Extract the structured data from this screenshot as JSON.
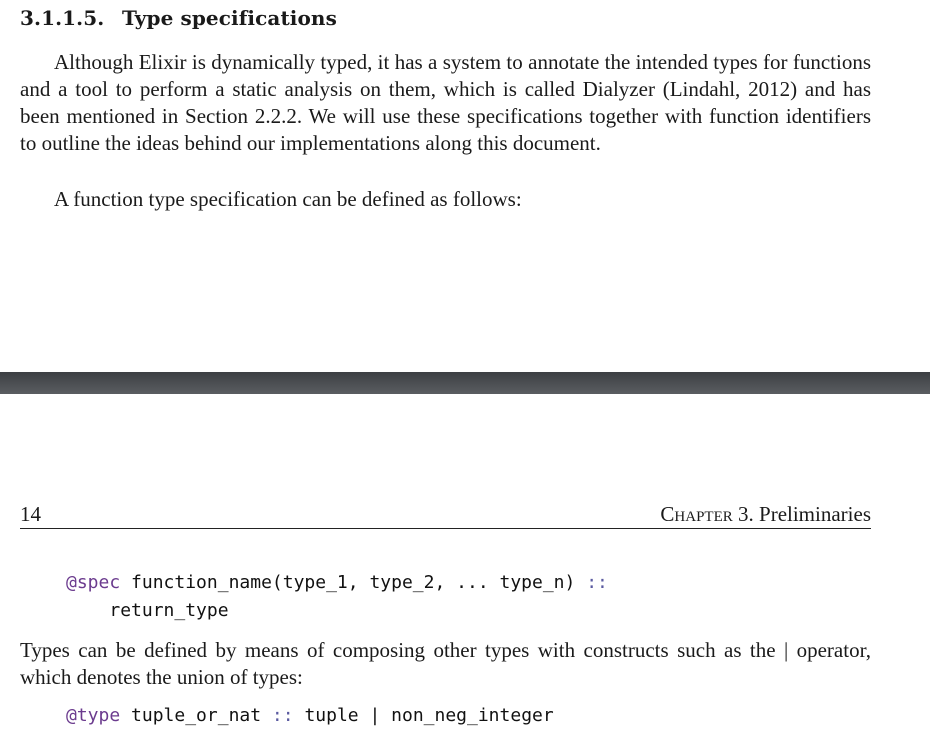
{
  "section": {
    "number": "3.1.1.5.",
    "title": "Type specifications"
  },
  "paragraphs": {
    "p1": "Although Elixir is dynamically typed, it has a system to annotate the intended types for functions and a tool to perform a static analysis on them, which is called Dialyzer (Lindahl, 2012) and has been mentioned in Section 2.2.2. We will use these specifications together with function identifiers to outline the ideas behind our implementations along this document.",
    "p2": "A function type specification can be defined as follows:",
    "p3": "Types can be defined by means of composing other types with constructs such as the | operator, which denotes the union of types:"
  },
  "running_head": {
    "page_number": "14",
    "chapter_prefix": "Chapter",
    "chapter_rest": "3. Preliminaries"
  },
  "code_blocks": {
    "spec": {
      "keyword": "@spec",
      "line1_rest": "function_name(type_1, type_2, ... type_n)",
      "op": "::",
      "line2": "return_type"
    },
    "type": {
      "keyword": "@type",
      "name": "tuple_or_nat",
      "op": "::",
      "rest": "tuple | non_neg_integer"
    }
  }
}
